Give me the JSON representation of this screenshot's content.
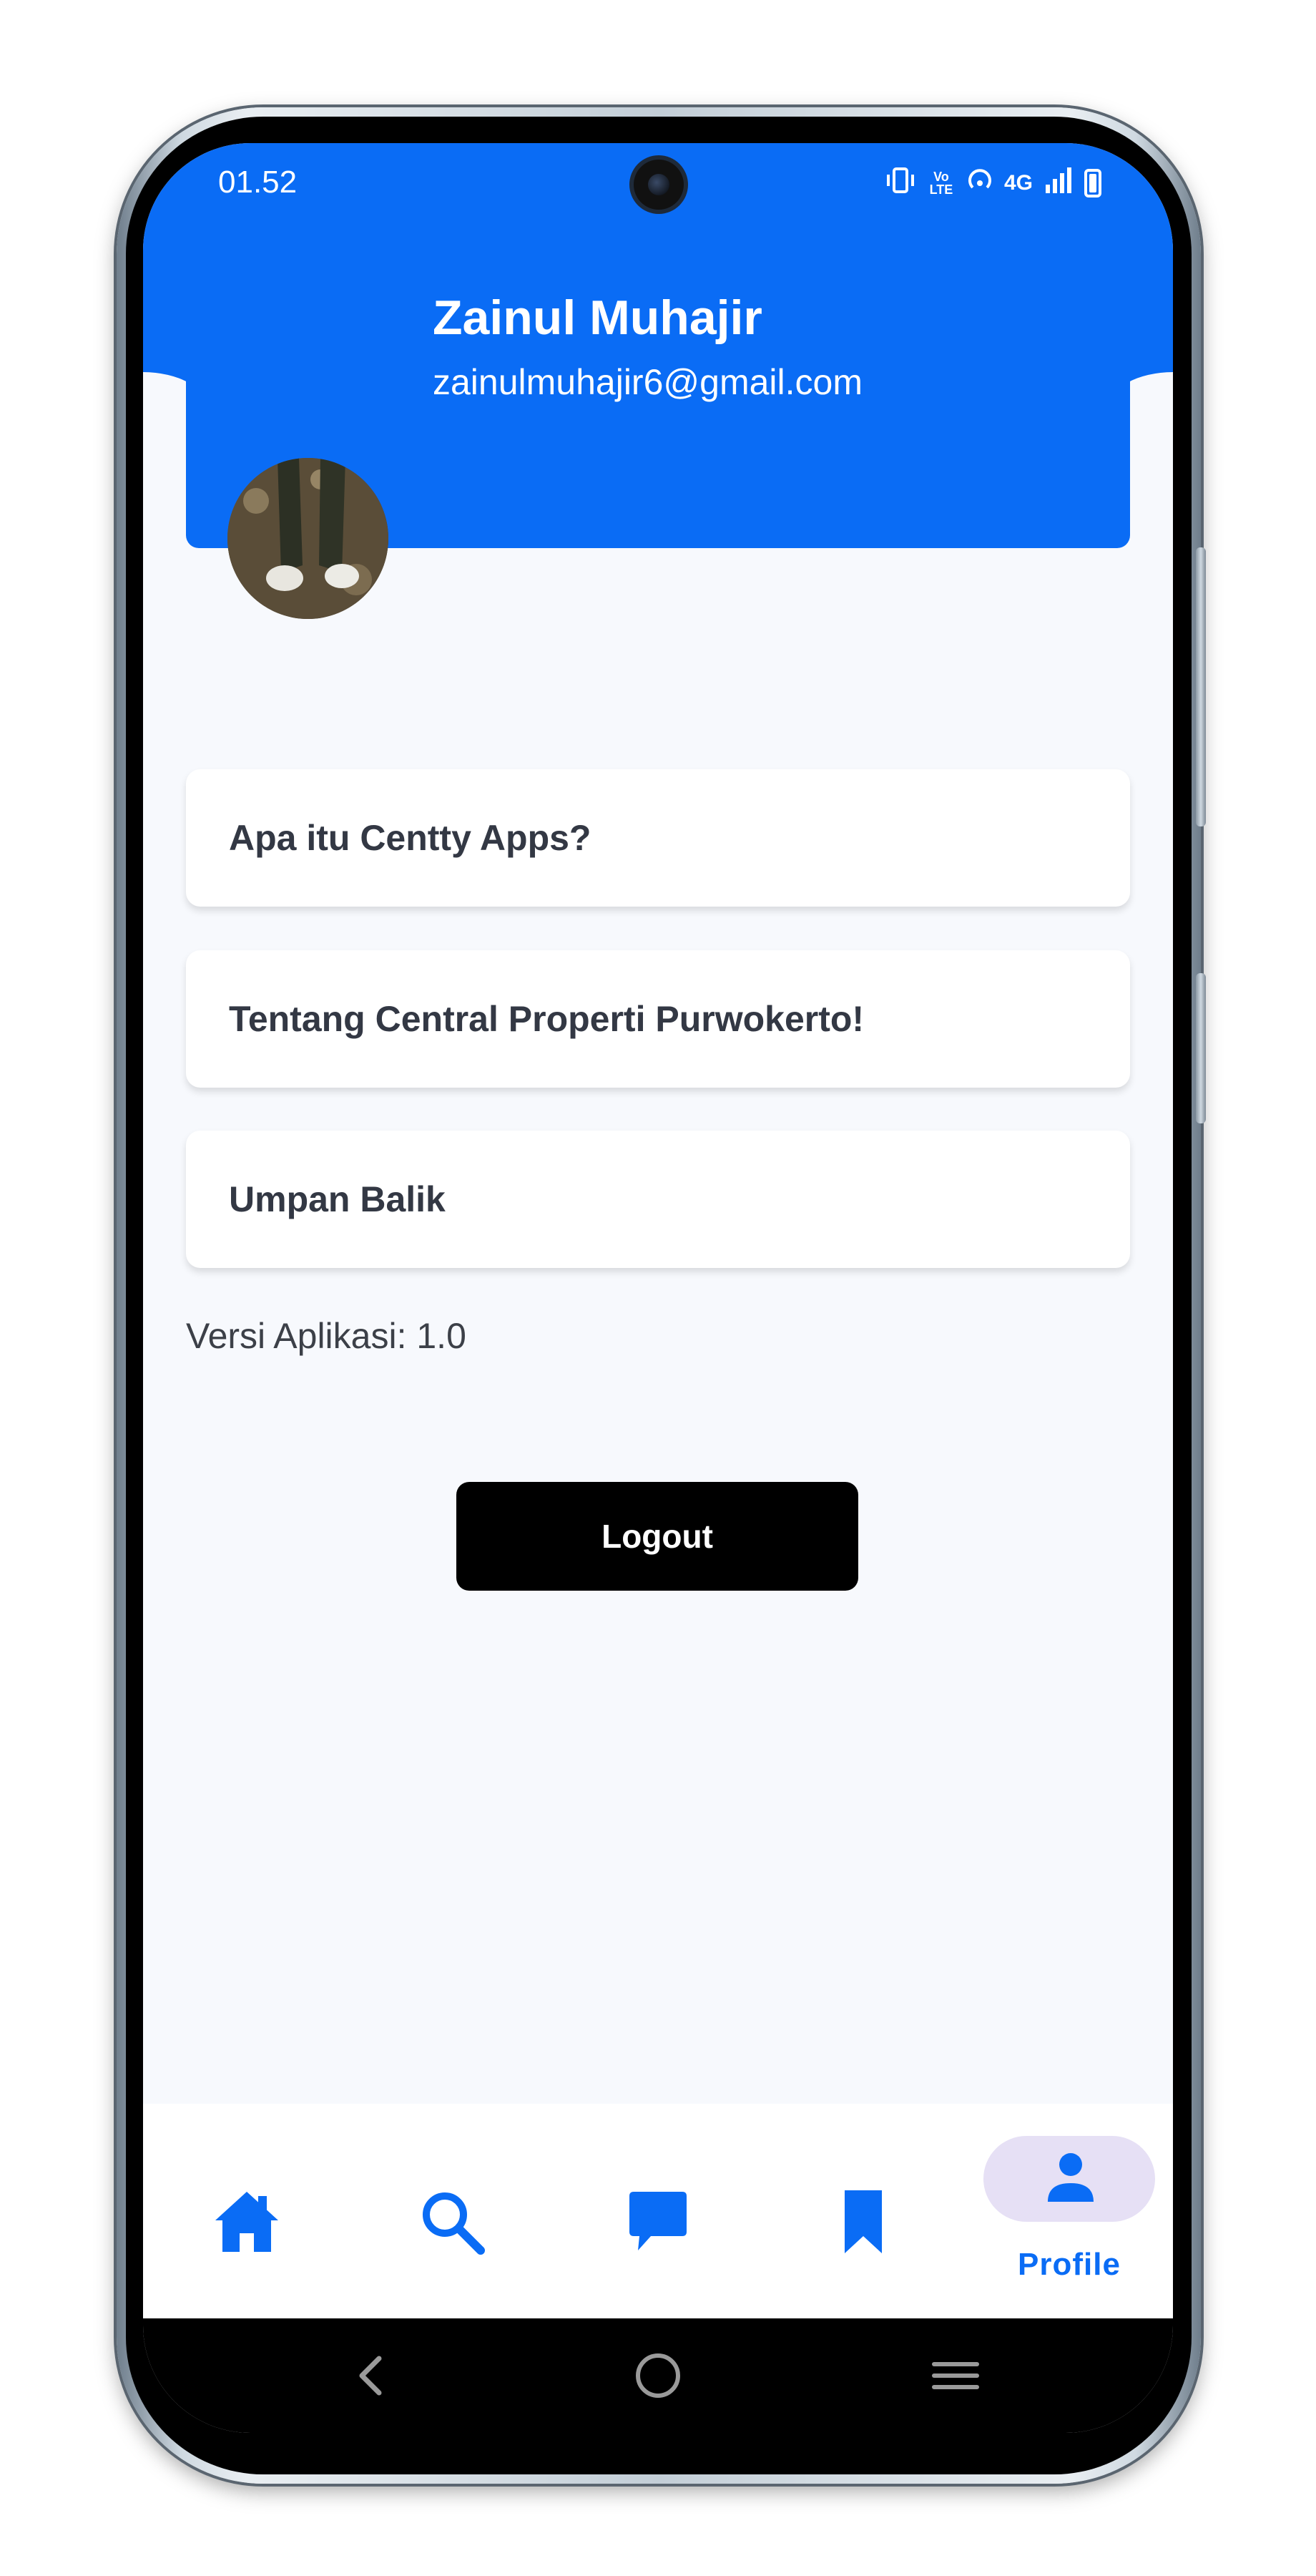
{
  "status_bar": {
    "time": "01.52",
    "icons": [
      "vibrate-icon",
      "volte-icon",
      "hotspot-icon",
      "4g-icon",
      "signal-icon",
      "battery-icon"
    ],
    "network_label": "4G",
    "volte_label": "Vo LTE"
  },
  "profile": {
    "name": "Zainul Muhajir",
    "email": "zainulmuhajir6@gmail.com"
  },
  "menu": {
    "items": [
      {
        "label": "Apa itu Centty Apps?"
      },
      {
        "label": "Tentang Central Properti Purwokerto!"
      },
      {
        "label": "Umpan Balik"
      }
    ]
  },
  "version_text": "Versi Aplikasi: 1.0",
  "logout_label": "Logout",
  "bottom_nav": {
    "items": [
      {
        "icon": "home-icon",
        "active": false
      },
      {
        "icon": "search-icon",
        "active": false
      },
      {
        "icon": "chat-icon",
        "active": false
      },
      {
        "icon": "bookmark-icon",
        "active": false
      },
      {
        "icon": "person-icon",
        "label": "Profile",
        "active": true
      }
    ]
  },
  "system_nav": [
    "back-icon",
    "home-circle-icon",
    "recents-icon"
  ],
  "colors": {
    "primary": "#0a6cf5",
    "background": "#f7f9fd",
    "active_pill": "#e6e0f5",
    "logout_bg": "#000000",
    "text_dark": "#333844"
  }
}
